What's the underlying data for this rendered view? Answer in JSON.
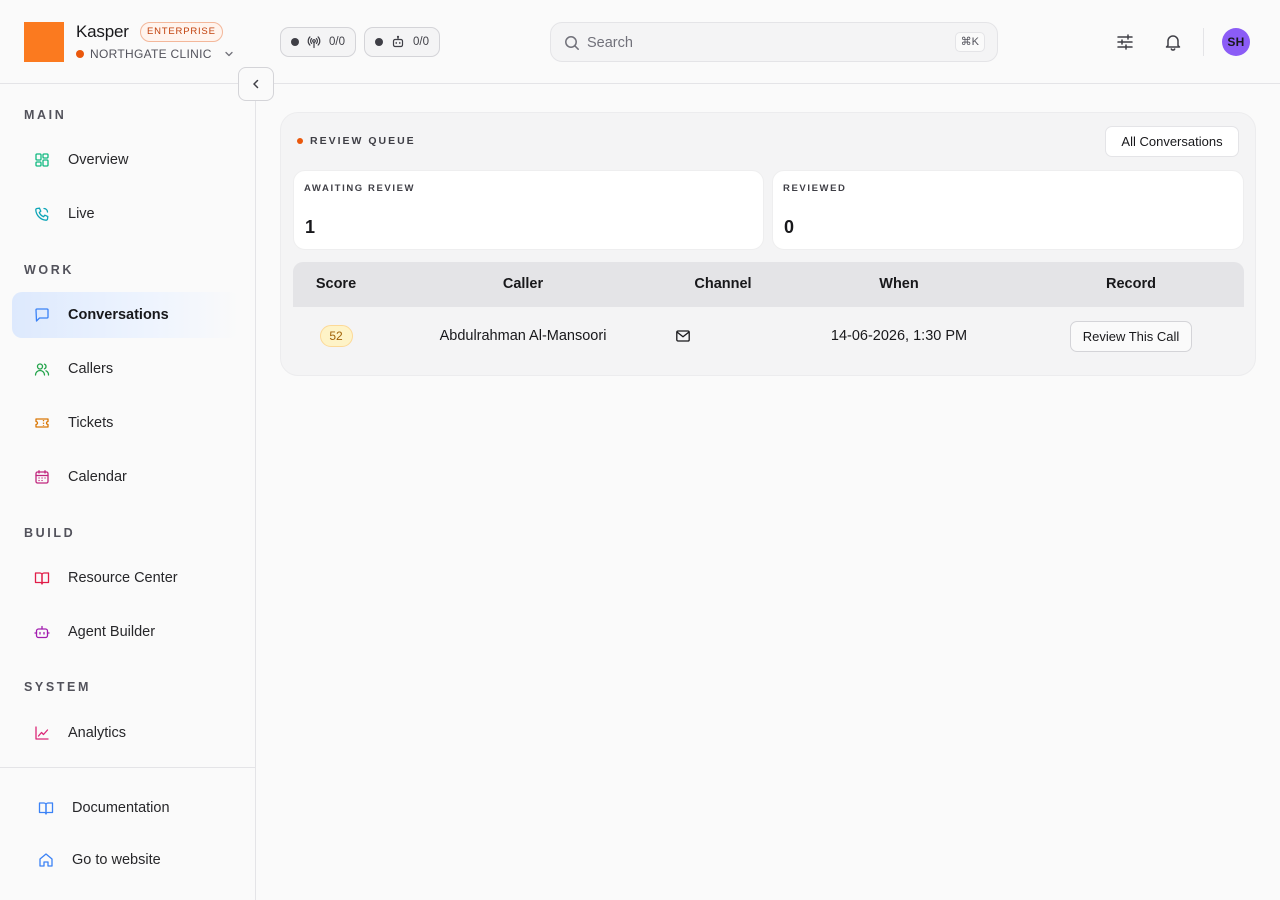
{
  "brand": {
    "name": "Kasper",
    "badge": "ENTERPRISE",
    "org": "NORTHGATE CLINIC",
    "logo_color": "#fb7a1f"
  },
  "header": {
    "pills": [
      {
        "icon": "broadcast-icon",
        "value": "0/0"
      },
      {
        "icon": "bot-icon",
        "value": "0/0"
      }
    ],
    "search": {
      "placeholder": "Search",
      "shortcut": "⌘K"
    },
    "avatar_initials": "SH",
    "avatar_color": "#8b5cf6"
  },
  "sidebar": {
    "sections": {
      "main": "MAIN",
      "work": "WORK",
      "build": "BUILD",
      "system": "SYSTEM"
    },
    "items": {
      "overview": "Overview",
      "live": "Live",
      "conversations": "Conversations",
      "callers": "Callers",
      "tickets": "Tickets",
      "calendar": "Calendar",
      "resource_center": "Resource Center",
      "agent_builder": "Agent Builder",
      "analytics": "Analytics"
    },
    "footer": {
      "documentation": "Documentation",
      "website": "Go to website"
    },
    "active_item": "Conversations"
  },
  "main": {
    "queue_title": "REVIEW QUEUE",
    "all_button": "All Conversations",
    "stats": {
      "awaiting_label": "AWAITING REVIEW",
      "awaiting_value": "1",
      "reviewed_label": "REVIEWED",
      "reviewed_value": "0"
    },
    "table": {
      "headers": {
        "score": "Score",
        "caller": "Caller",
        "channel": "Channel",
        "when": "When",
        "record": "Record"
      },
      "rows": [
        {
          "score": "52",
          "caller": "Abdulrahman Al-Mansoori",
          "channel": "mail-icon",
          "when": "14-06-2026, 1:30 PM",
          "action": "Review This Call"
        }
      ]
    }
  },
  "colors": {
    "accent": "#ea580c",
    "active_nav": "#dde9fd",
    "score_badge": "#fef3c7"
  }
}
